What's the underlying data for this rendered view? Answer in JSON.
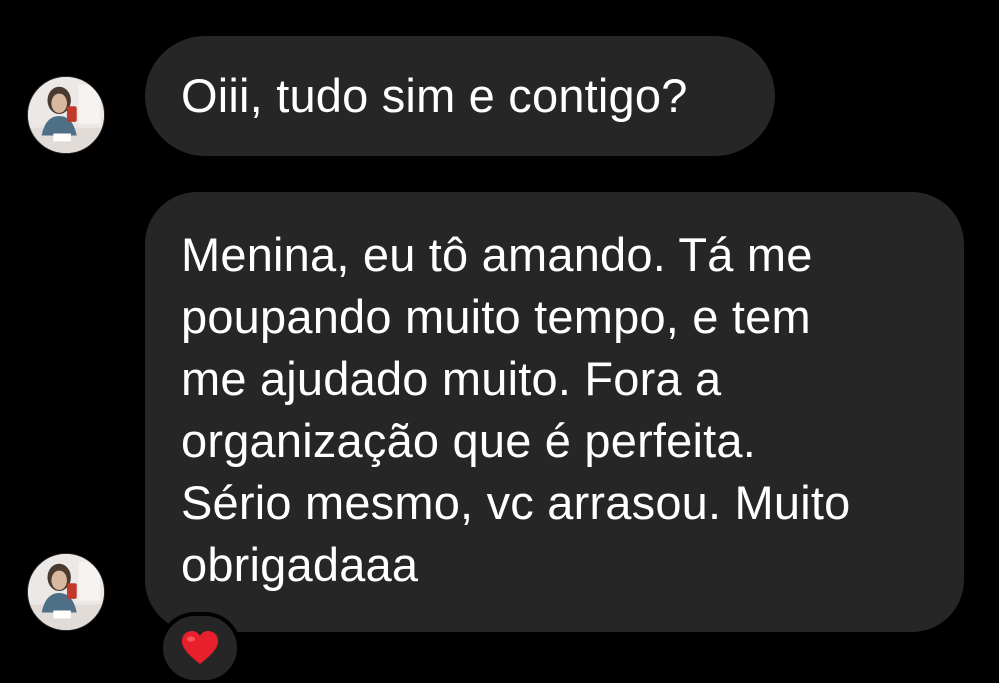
{
  "conversation": {
    "messages": [
      {
        "text": "Oiii, tudo sim e contigo?"
      },
      {
        "lines": [
          "Menina, eu tô amando. Tá me",
          "poupando muito tempo, e tem",
          "me ajudado muito. Fora a",
          "organização que é perfeita.",
          "Sério mesmo, vc arrasou. Muito",
          "obrigadaaa"
        ],
        "reaction": {
          "icon": "red-heart-icon",
          "color": "#e8202b"
        }
      }
    ],
    "colors": {
      "background": "#000000",
      "bubble": "#262626",
      "text": "#ffffff"
    }
  }
}
